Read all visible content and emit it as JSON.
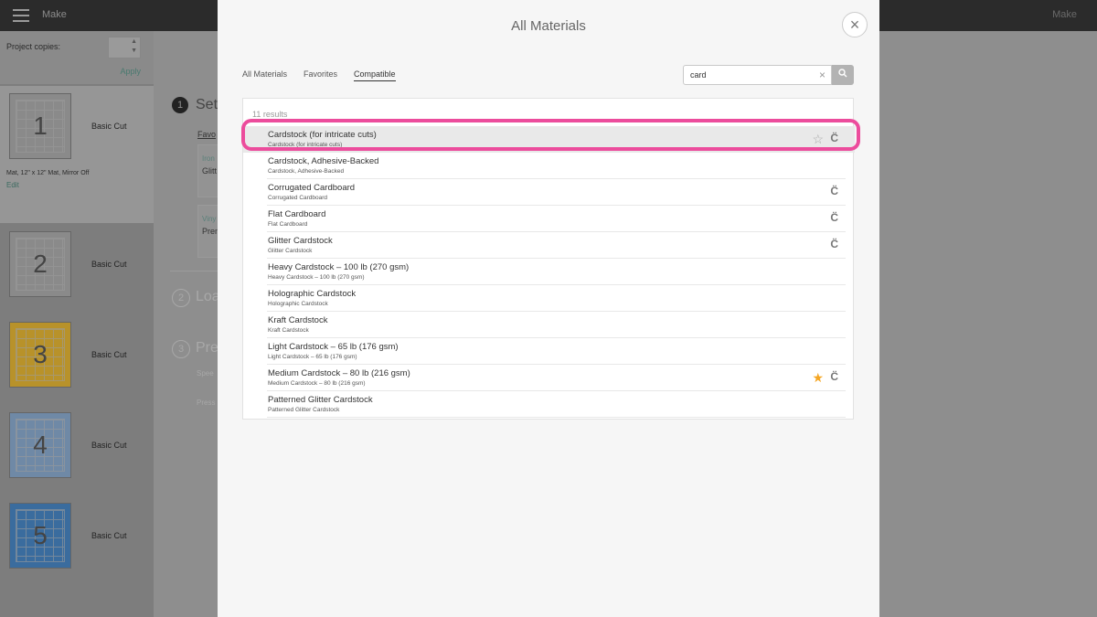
{
  "topbar": {
    "title": "Make",
    "right_label": "Make"
  },
  "sidebar": {
    "copies_label": "Project copies:",
    "apply_label": "Apply",
    "mats": [
      {
        "number": "1",
        "label": "Basic Cut",
        "info": "Mat, 12\" x 12\" Mat, Mirror Off",
        "edit": "Edit",
        "color": "#8a8a8a"
      },
      {
        "number": "2",
        "label": "Basic Cut",
        "color": "#8a8a8a"
      },
      {
        "number": "3",
        "label": "Basic Cut",
        "color": "#b8922a"
      },
      {
        "number": "4",
        "label": "Basic Cut",
        "color": "#6f89a6"
      },
      {
        "number": "5",
        "label": "Basic Cut",
        "color": "#3a6c9e"
      }
    ]
  },
  "main": {
    "step1": "Set",
    "step1_num": "1",
    "step2": "Loa",
    "step2_num": "2",
    "step3": "Pre",
    "step3_num": "3",
    "fav_tab": "Favo",
    "card1": "Iron",
    "card1b": "Glitt",
    "card2": "Viny",
    "card2b": "Pren",
    "speed": "Spee",
    "press": "Press"
  },
  "modal": {
    "title": "All Materials",
    "close_icon": "×",
    "tabs": [
      "All Materials",
      "Favorites",
      "Compatible"
    ],
    "active_tab": "Compatible",
    "search": {
      "value": "card",
      "clear_icon": "×",
      "go_icon": "search-icon"
    },
    "results_count": "11 results",
    "results": [
      {
        "name": "Cardstock (for intricate cuts)",
        "sub": "Cardstock (for intricate cuts)",
        "star": "outline",
        "cut": true,
        "highlight": true
      },
      {
        "name": "Cardstock, Adhesive-Backed",
        "sub": "Cardstock, Adhesive-Backed",
        "star": "none",
        "cut": false
      },
      {
        "name": "Corrugated Cardboard",
        "sub": "Corrugated Cardboard",
        "star": "none",
        "cut": true
      },
      {
        "name": "Flat Cardboard",
        "sub": "Flat Cardboard",
        "star": "none",
        "cut": true
      },
      {
        "name": "Glitter Cardstock",
        "sub": "Glitter Cardstock",
        "star": "none",
        "cut": true
      },
      {
        "name": "Heavy Cardstock – 100 lb (270 gsm)",
        "sub": "Heavy Cardstock – 100 lb (270 gsm)",
        "star": "none",
        "cut": false
      },
      {
        "name": "Holographic Cardstock",
        "sub": "Holographic Cardstock",
        "star": "none",
        "cut": false
      },
      {
        "name": "Kraft Cardstock",
        "sub": "Kraft Cardstock",
        "star": "none",
        "cut": false
      },
      {
        "name": "Light Cardstock – 65 lb (176 gsm)",
        "sub": "Light Cardstock – 65 lb (176 gsm)",
        "star": "none",
        "cut": false
      },
      {
        "name": "Medium Cardstock – 80 lb (216 gsm)",
        "sub": "Medium Cardstock – 80 lb (216 gsm)",
        "star": "filled",
        "cut": true
      },
      {
        "name": "Patterned Glitter Cardstock",
        "sub": "Patterned Glitter Cardstock",
        "star": "none",
        "cut": false
      }
    ],
    "highlight_color": "#ec4c9c",
    "star_color": "#f5a623"
  }
}
